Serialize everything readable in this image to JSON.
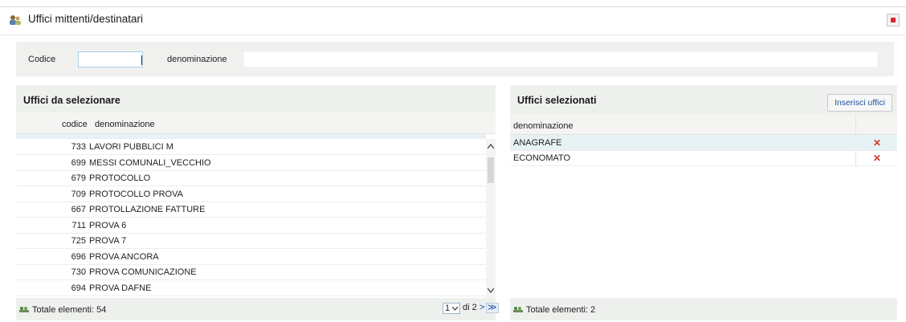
{
  "header": {
    "title": "Uffici mittenti/destinatari",
    "icon": "office-people-icon",
    "close_icon": "close-red-icon"
  },
  "filter": {
    "codice_label": "Codice",
    "codice_value": "",
    "denominazione_label": "denominazione",
    "denominazione_value": ""
  },
  "left": {
    "title": "Uffici da selezionare",
    "columns": {
      "codice": "codice",
      "denominazione": "denominazione"
    },
    "rows": [
      {
        "codice": "733",
        "denominazione": "LAVORI PUBBLICI M"
      },
      {
        "codice": "699",
        "denominazione": "MESSI COMUNALI_VECCHIO"
      },
      {
        "codice": "679",
        "denominazione": "PROTOCOLLO"
      },
      {
        "codice": "709",
        "denominazione": "PROTOCOLLO PROVA"
      },
      {
        "codice": "667",
        "denominazione": "PROTOLLAZIONE FATTURE"
      },
      {
        "codice": "711",
        "denominazione": "PROVA 6"
      },
      {
        "codice": "725",
        "denominazione": "PROVA 7"
      },
      {
        "codice": "696",
        "denominazione": "PROVA ANCORA"
      },
      {
        "codice": "730",
        "denominazione": "PROVA COMUNICAZIONE"
      },
      {
        "codice": "694",
        "denominazione": "PROVA DAFNE"
      }
    ],
    "footer": "Totale elementi: 54",
    "pager": {
      "page": "1",
      "of_label": "di 2",
      "next": ">",
      "last": "≫"
    }
  },
  "right": {
    "title": "Uffici selezionati",
    "button": "Inserisci uffici",
    "columns": {
      "denominazione": "denominazione"
    },
    "rows": [
      {
        "denominazione": "ANAGRAFE"
      },
      {
        "denominazione": "ECONOMATO"
      }
    ],
    "remove_icon": "delete-x-icon",
    "footer": "Totale elementi: 2"
  }
}
